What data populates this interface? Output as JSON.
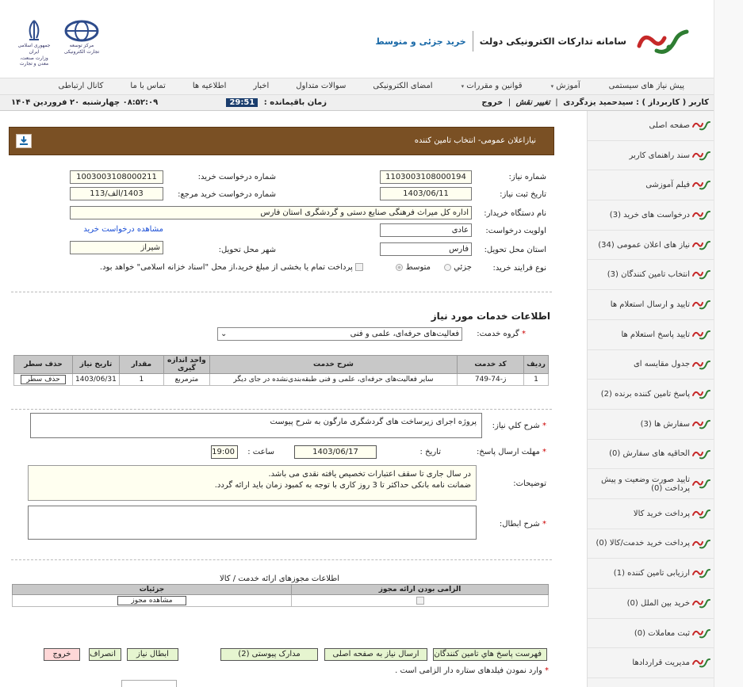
{
  "header": {
    "system_title": "سامانه تدارکات الکترونیکی دولت",
    "system_subtitle": "خرید جزئی و متوسط",
    "emblem1_text": "جمهوری اسلامی ایران\nوزارت صنعت، معدن و تجارت",
    "emblem2_text": "مرکز توسعه تجارت الکترونیکی"
  },
  "menu": {
    "items": [
      "پیش نیاز های سیستمی",
      "آموزش",
      "قوانین و مقررات",
      "امضای الکترونیکی",
      "سوالات متداول",
      "اخبار",
      "اطلاعیه ها",
      "تماس با ما",
      "کانال ارتباطی"
    ]
  },
  "status": {
    "user": "کاربر ( کاربرداز ) : سیدحمید یزدگردی",
    "change_role": "تغییر نقش",
    "logout": "خروج",
    "remaining_label": "زمان باقیمانده :",
    "remaining_time": "29:51",
    "datetime": "۰۸:۵۲:۰۹ چهارشنبه ۲۰ فروردین ۱۴۰۴"
  },
  "sidebar": {
    "items": [
      "صفحه اصلی",
      "سند راهنمای کاربر",
      "فیلم آموزشی",
      "درخواست های خرید (3)",
      "نیاز های اعلان عمومی (34)",
      "انتخاب تامین کنندگان (3)",
      "تایید و ارسال استعلام ها",
      "تایید پاسخ استعلام ها",
      "جدول مقایسه ای",
      "پاسخ تامین کننده برنده (2)",
      "سفارش ها (3)",
      "الحاقیه های سفارش (0)",
      "تایید صورت وضعیت و پیش پرداخت (0)",
      "پرداخت خرید کالا",
      "پرداخت خرید خدمت/کالا (0)",
      "ارزیابی تامین کننده (1)",
      "خرید بین الملل  (0)",
      "ثبت معاملات  (0)",
      "مدیریت قراردادها"
    ]
  },
  "page": {
    "title": "نیازاعلان عمومی- انتخاب تامین کننده",
    "need_number_label": "شماره نیاز:",
    "need_number": "1103003108000194",
    "purchase_request_label": "شماره درخواست خرید:",
    "purchase_request": "1003003108000211",
    "register_date_label": "تاریخ ثبت نیاز:",
    "register_date": "1403/06/11",
    "ref_number_label": "شماره درخواست خرید مرجع:",
    "ref_number": "1403/الف/113",
    "buyer_label": "نام دستگاه خریدار:",
    "buyer": "اداره کل میراث فرهنگی  صنایع دستی و گردشگری استان فارس",
    "priority_label": "اولویت درخواست:",
    "priority": "عادی",
    "view_request": "مشاهده درخواست خرید",
    "province_label": "استان محل تحویل:",
    "province": "فارس",
    "city_label": "شهر محل تحویل:",
    "city": "شیراز",
    "process_label": "نوع فرایند خرید:",
    "process_small": "جزئي",
    "process_medium": "متوسط",
    "payment_note": "پرداخت تمام یا بخشی از مبلغ خرید،از محل \"اسناد خزانه اسلامی\" خواهد بود."
  },
  "services": {
    "title": "اطلاعات خدمات مورد نیاز",
    "group_label": "گروه خدمت:",
    "group_value": "فعالیت‌های حرفه‌ای، علمی و فنی",
    "columns": [
      "ردیف",
      "کد خدمت",
      "شرح خدمت",
      "واحد اندازه گیری",
      "مقدار",
      "تاریخ نیاز",
      "حذف سطر"
    ],
    "rows": [
      {
        "row": "1",
        "code": "ز-74-749",
        "desc": "سایر فعالیت‌های حرفه‌ای، علمی و فنی طبقه‌بندی‌نشده در جای دیگر",
        "unit": "مترمربع",
        "qty": "1",
        "date": "1403/06/31",
        "delete": "حذف سطر"
      }
    ]
  },
  "details": {
    "general_desc_label": "شرح کلي نیاز:",
    "general_desc": "پروژه اجرای زیرساخت های گردشگری مارگون به شرح پیوست",
    "deadline_label": "مهلت ارسال پاسخ:",
    "date_label": "تاریخ :",
    "deadline_date": "1403/06/17",
    "time_label": "ساعت :",
    "deadline_time": "19:00",
    "notes_label": "توضیحات:",
    "notes_line1": "در سال جاری تا سقف اعتبارات تخصیص یافته نقدی می باشد.",
    "notes_line2": "ضمانت نامه بانکی حداکثر تا 3 روز کاری با توجه به کمبود زمان باید ارائه گردد.",
    "cancel_desc_label": "شرح ابطال:"
  },
  "permits": {
    "title": "اطلاعات مجوزهای ارائه خدمت / کالا",
    "col_required": "الزامی بودن ارائه مجوز",
    "col_details": "جزئیات",
    "view_permit": "مشاهده مجوز"
  },
  "actions": {
    "supplier_list": "فهرست پاسخ هاي تامين كنندگان",
    "send_home": "ارسال نیاز به صفحه اصلی",
    "attachments": "مدارک پیوستی (2)",
    "cancel_need": "ابطال نیاز",
    "withdraw": "انصراف",
    "exit": "خروج",
    "footer_note": "وارد نمودن فیلدهای ستاره دار الزامی است ."
  },
  "colors": {
    "title_bg": "#7a5024",
    "accent_blue": "#1b6aa8",
    "clock_bg": "#1a3d6d",
    "required": "#cc0000"
  }
}
